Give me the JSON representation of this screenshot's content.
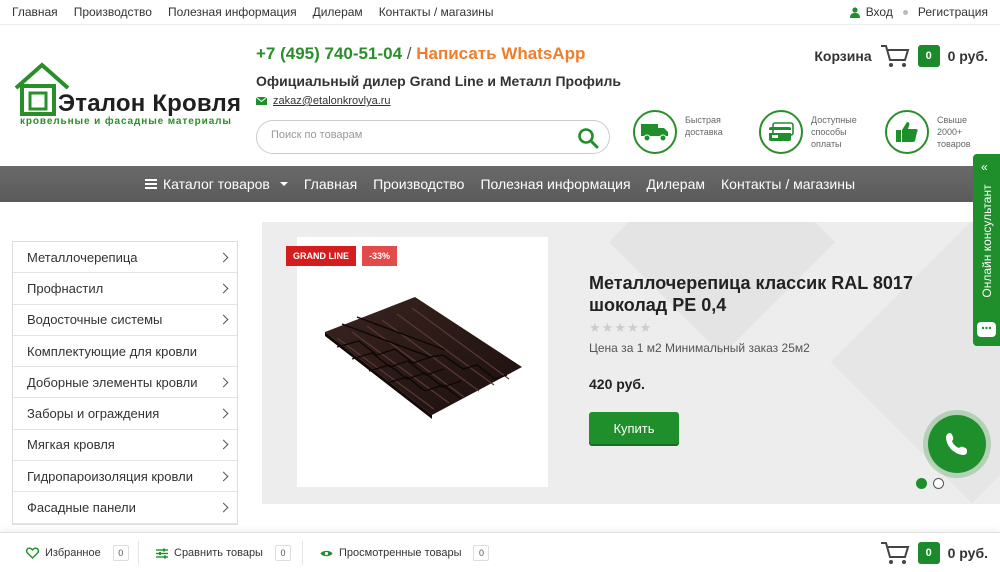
{
  "topbar": {
    "links": [
      "Главная",
      "Производство",
      "Полезная информация",
      "Дилерам",
      "Контакты / магазины"
    ],
    "login": "Вход",
    "register": "Регистрация"
  },
  "logo": {
    "name": "Эталон Кровля",
    "tagline": "кровельные и фасадные материалы"
  },
  "header": {
    "phone": "+7 (495) 740-51-04",
    "separator": "/",
    "whatsapp": "Написать WhatsApp",
    "dealer": "Официальный дилер Grand Line и Металл Профиль",
    "email": "zakaz@etalonkrovlya.ru",
    "search_placeholder": "Поиск по товарам",
    "cart_label": "Корзина",
    "cart_count": "0",
    "cart_total": "0 руб."
  },
  "features": [
    {
      "line1": "Быстрая",
      "line2": "доставка",
      "line3": "",
      "icon": "truck-icon"
    },
    {
      "line1": "Доступные",
      "line2": "способы",
      "line3": "оплаты",
      "icon": "payment-card-icon"
    },
    {
      "line1": "Свыше",
      "line2": "2000+",
      "line3": "товаров",
      "icon": "thumbs-up-icon"
    }
  ],
  "nav": {
    "catalog": "Каталог товаров",
    "items": [
      "Главная",
      "Производство",
      "Полезная информация",
      "Дилерам",
      "Контакты / магазины"
    ]
  },
  "sidemenu": [
    {
      "label": "Металлочерепица",
      "arrow": true
    },
    {
      "label": "Профнастил",
      "arrow": true
    },
    {
      "label": "Водосточные системы",
      "arrow": true
    },
    {
      "label": "Комплектующие для кровли",
      "arrow": false
    },
    {
      "label": "Доборные элементы кровли",
      "arrow": true
    },
    {
      "label": "Заборы и ограждения",
      "arrow": true
    },
    {
      "label": "Мягкая кровля",
      "arrow": true
    },
    {
      "label": "Гидропароизоляция кровли",
      "arrow": true
    },
    {
      "label": "Фасадные панели",
      "arrow": true
    }
  ],
  "slide": {
    "tag_brand": "GRAND LINE",
    "tag_discount": "-33%",
    "title_line1": "Металлочерепица классик RAL 8017",
    "title_line2": "шоколад PE 0,4",
    "rating": 0,
    "note": "Цена за 1 м2 Минимальный заказ 25м2",
    "price": "420 руб.",
    "buy": "Купить",
    "active_slide": 1,
    "slide_count": 2
  },
  "consultant": {
    "label": "Онлайн консультант",
    "arrow": "«"
  },
  "bottombar": {
    "favorites": "Избранное",
    "favorites_count": "0",
    "compare": "Сравнить товары",
    "compare_count": "0",
    "viewed": "Просмотренные товары",
    "viewed_count": "0",
    "cart_count": "0",
    "cart_total": "0 руб."
  },
  "colors": {
    "brand_green": "#1f8f2c",
    "whatsapp_orange": "#f07d2a",
    "tag_red": "#d41d1d",
    "nav_gray": "#5f5f5f"
  }
}
